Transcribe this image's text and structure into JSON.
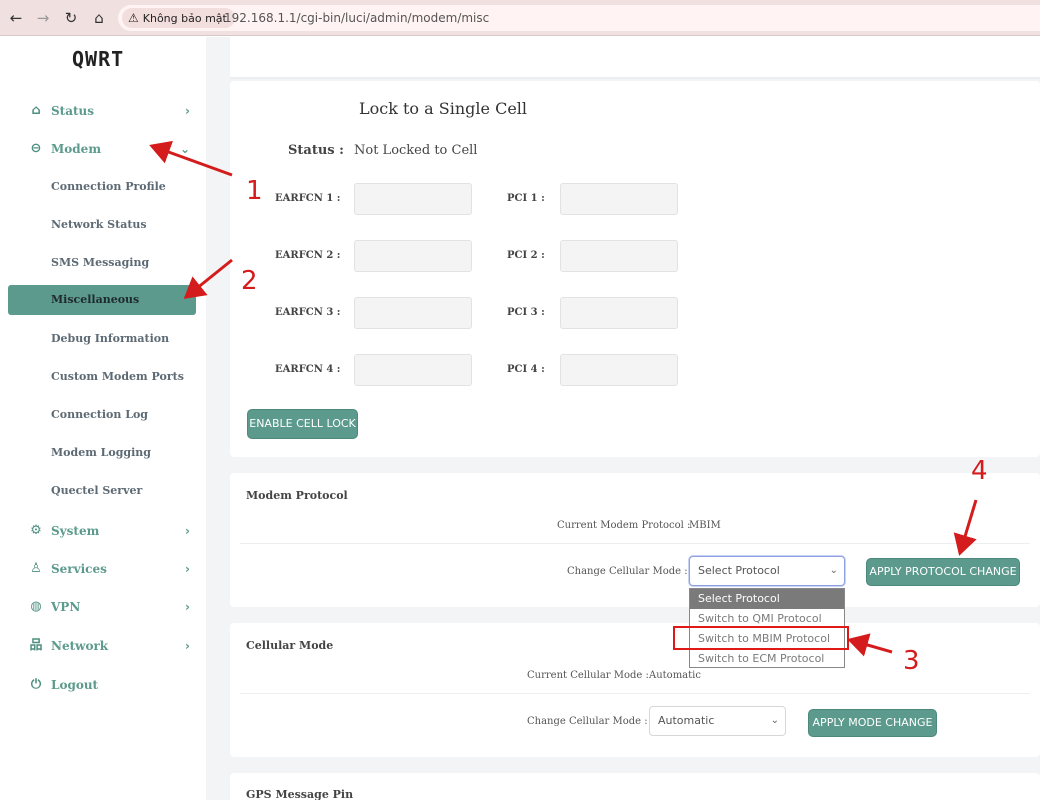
{
  "browser": {
    "secure_label": "Không bảo mật",
    "url": "192.168.1.1/cgi-bin/luci/admin/modem/misc"
  },
  "sidebar": {
    "brand": "QWRT",
    "items": [
      {
        "label": "Status",
        "icon": "home-icon"
      },
      {
        "label": "Modem",
        "icon": "hdd-icon"
      },
      {
        "label": "System",
        "icon": "gear-icon"
      },
      {
        "label": "Services",
        "icon": "user-gear-icon"
      },
      {
        "label": "VPN",
        "icon": "globe-icon"
      },
      {
        "label": "Network",
        "icon": "sitemap-icon"
      },
      {
        "label": "Logout",
        "icon": "power-icon"
      }
    ],
    "modem_sub": [
      "Connection Profile",
      "Network Status",
      "SMS Messaging",
      "Miscellaneous",
      "Debug Information",
      "Custom Modem Ports",
      "Connection Log",
      "Modem Logging",
      "Quectel Server"
    ]
  },
  "cell_lock": {
    "title": "Lock to a Single Cell",
    "status_label": "Status :",
    "status_value": "Not Locked to Cell",
    "earfcn_labels": [
      "EARFCN 1 :",
      "EARFCN 2 :",
      "EARFCN 3 :",
      "EARFCN 4 :"
    ],
    "pci_labels": [
      "PCI 1 :",
      "PCI 2 :",
      "PCI 3 :",
      "PCI 4 :"
    ],
    "enable_button": "ENABLE CELL LOCK"
  },
  "modem_protocol": {
    "title": "Modem Protocol",
    "current_label": "Current Modem Protocol :",
    "current_value": "MBIM",
    "change_label": "Change Cellular Mode :",
    "select_value": "Select Protocol",
    "apply_button": "APPLY PROTOCOL CHANGE",
    "options": [
      "Select Protocol",
      "Switch to QMI Protocol",
      "Switch to MBIM Protocol",
      "Switch to ECM Protocol"
    ]
  },
  "cellular_mode": {
    "title": "Cellular Mode",
    "current_label": "Current Cellular Mode :",
    "current_value": "Automatic",
    "change_label": "Change Cellular Mode :",
    "select_value": "Automatic",
    "apply_button": "APPLY MODE CHANGE"
  },
  "gps": {
    "title": "GPS Message Pin"
  },
  "annotations": [
    "1",
    "2",
    "3",
    "4"
  ],
  "colors": {
    "accent": "#5b9a8c",
    "annotation": "#d41c1c",
    "browser_bar": "#f0e0e0"
  }
}
